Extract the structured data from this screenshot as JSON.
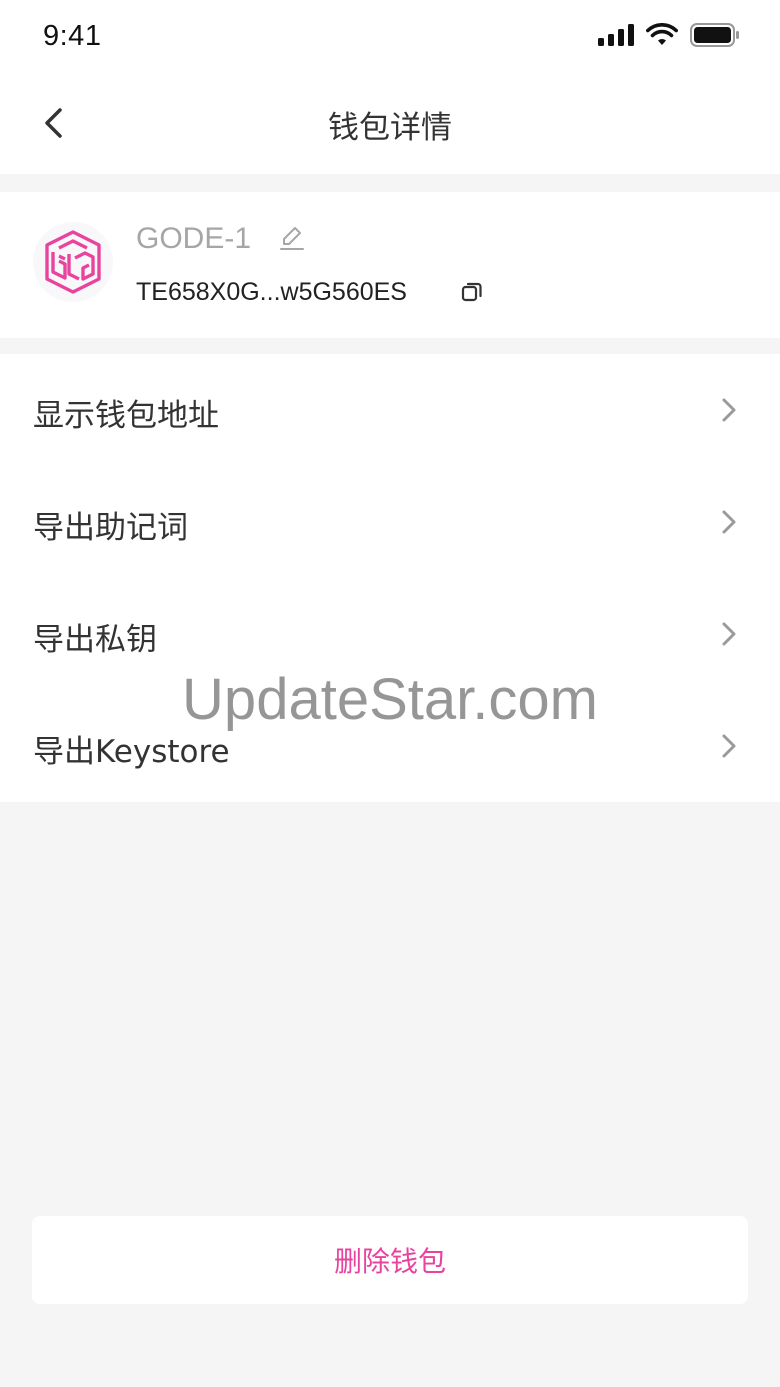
{
  "status_bar": {
    "time": "9:41"
  },
  "nav": {
    "title": "钱包详情"
  },
  "wallet": {
    "name": "GODE-1",
    "address": "TE658X0G...w5G560ES"
  },
  "menu": {
    "items": [
      {
        "label": "显示钱包地址"
      },
      {
        "label": "导出助记词"
      },
      {
        "label": "导出私钥"
      },
      {
        "label": "导出Keystore"
      }
    ]
  },
  "watermark": "UpdateStar.com",
  "delete_button": {
    "label": "删除钱包"
  },
  "colors": {
    "accent": "#e8449f",
    "background": "#f5f5f5",
    "card": "#ffffff"
  },
  "icons": [
    "back-icon",
    "edit-icon",
    "copy-icon",
    "chevron-right-icon",
    "signal-icon",
    "wifi-icon",
    "battery-icon",
    "wallet-logo-icon"
  ]
}
